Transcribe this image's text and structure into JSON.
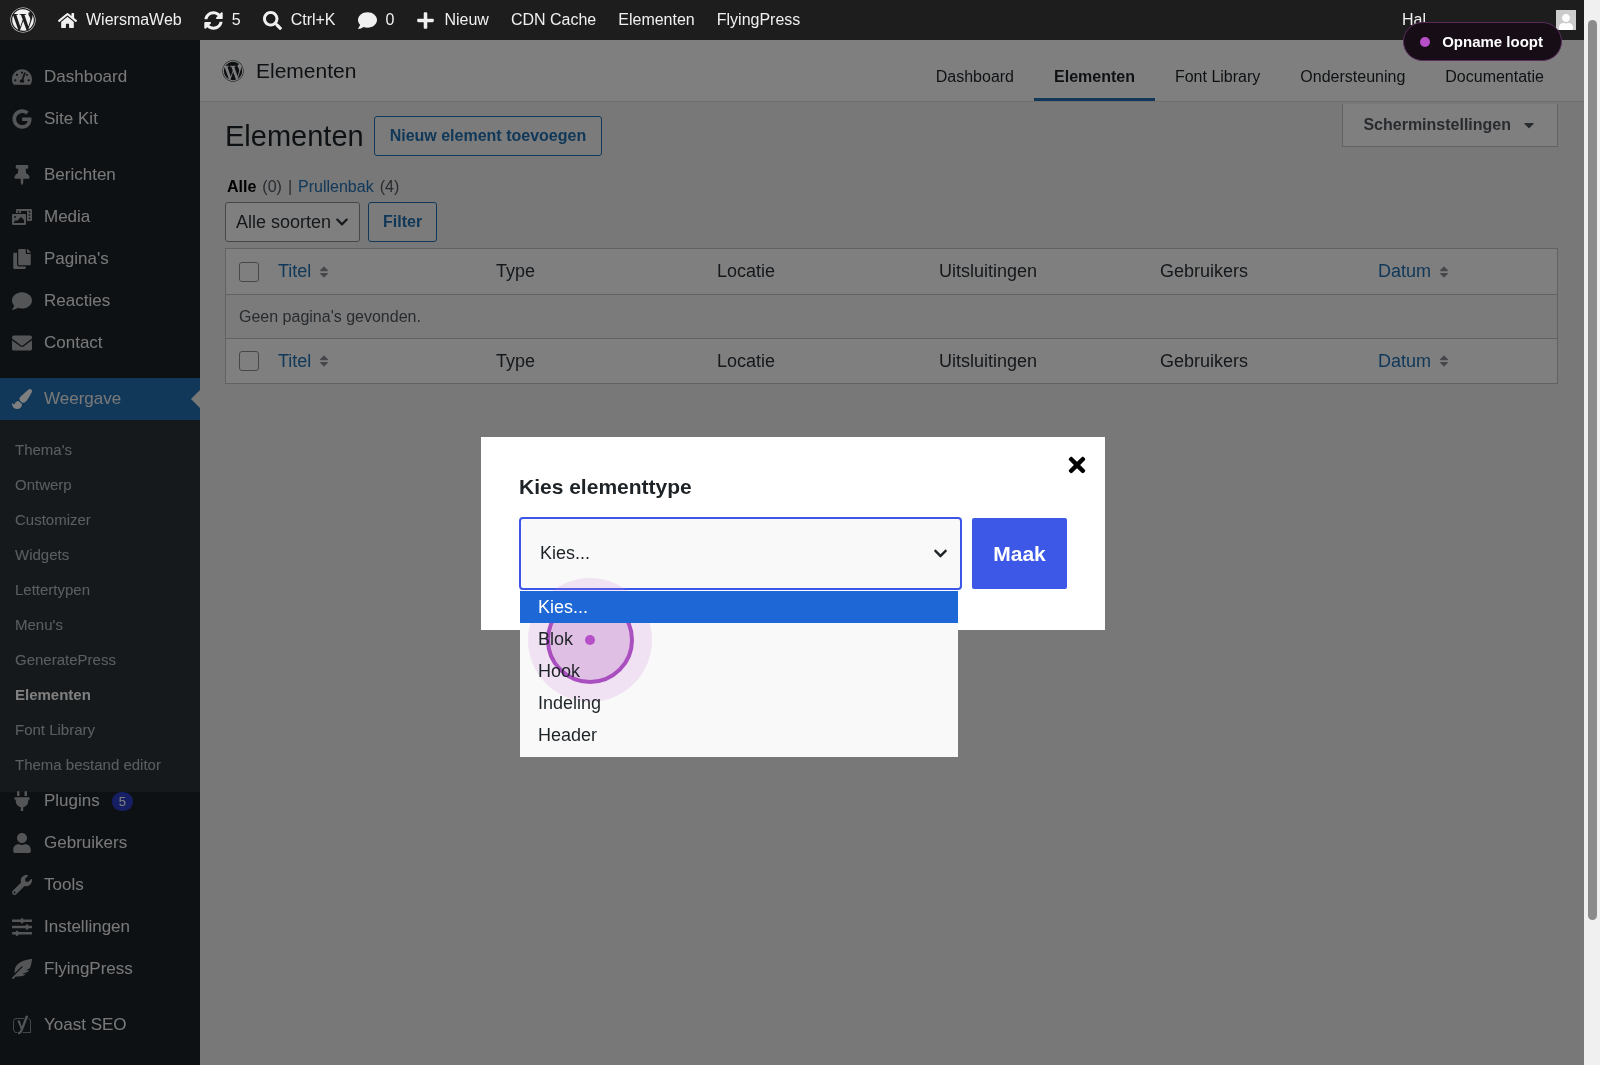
{
  "admin_bar": {
    "items": [
      {
        "kind": "logo"
      },
      {
        "kind": "home",
        "label": "WiersmaWeb"
      },
      {
        "kind": "updates",
        "label": "5"
      },
      {
        "kind": "search",
        "label": "Ctrl+K"
      },
      {
        "kind": "comments",
        "label": "0"
      },
      {
        "kind": "new",
        "label": "Nieuw"
      },
      {
        "kind": "text",
        "label": "CDN Cache"
      },
      {
        "kind": "text",
        "label": "Elementen"
      },
      {
        "kind": "text",
        "label": "FlyingPress"
      }
    ],
    "greeting": "Hal"
  },
  "recording_badge": {
    "label": "Opname loopt"
  },
  "sidebar": {
    "groups": [
      [
        {
          "label": "Dashboard",
          "selected": false
        },
        {
          "label": "Site Kit",
          "selected": false
        }
      ],
      [
        {
          "label": "Berichten",
          "selected": false
        },
        {
          "label": "Media",
          "selected": false
        },
        {
          "label": "Pagina's",
          "selected": false
        },
        {
          "label": "Reacties",
          "selected": false
        },
        {
          "label": "Contact",
          "selected": false
        }
      ],
      [
        {
          "label": "Weergave",
          "selected": true,
          "children": [
            {
              "label": "Thema's",
              "selected": false
            },
            {
              "label": "Ontwerp",
              "selected": false
            },
            {
              "label": "Customizer",
              "selected": false
            },
            {
              "label": "Widgets",
              "selected": false
            },
            {
              "label": "Lettertypen",
              "selected": false
            },
            {
              "label": "Menu's",
              "selected": false
            },
            {
              "label": "GeneratePress",
              "selected": false
            },
            {
              "label": "Elementen",
              "selected": true
            },
            {
              "label": "Font Library",
              "selected": false
            },
            {
              "label": "Thema bestand editor",
              "selected": false
            }
          ]
        },
        {
          "label": "Plugins",
          "selected": false,
          "badge": "5"
        },
        {
          "label": "Gebruikers",
          "selected": false
        },
        {
          "label": "Tools",
          "selected": false
        },
        {
          "label": "Instellingen",
          "selected": false
        },
        {
          "label": "FlyingPress",
          "selected": false
        }
      ],
      [
        {
          "label": "Yoast SEO",
          "selected": false
        }
      ]
    ]
  },
  "header": {
    "title": "Elementen",
    "tabs": [
      {
        "label": "Dashboard",
        "selected": false
      },
      {
        "label": "Elementen",
        "selected": true
      },
      {
        "label": "Font Library",
        "selected": false
      },
      {
        "label": "Ondersteuning",
        "selected": false
      },
      {
        "label": "Documentatie",
        "selected": false
      }
    ]
  },
  "screen_options": "Scherminstellingen",
  "page": {
    "title": "Elementen",
    "add_button": "Nieuw element toevoegen",
    "views": [
      {
        "label": "Alle",
        "count": "(0)",
        "selected": true
      },
      {
        "label": "Prullenbak",
        "count": "(4)",
        "selected": false
      }
    ],
    "views_separator": "|",
    "type_filter": "Alle soorten",
    "filter_button": "Filter"
  },
  "table": {
    "columns": [
      {
        "label": "Titel",
        "sortable": true
      },
      {
        "label": "Type",
        "sortable": false
      },
      {
        "label": "Locatie",
        "sortable": false
      },
      {
        "label": "Uitsluitingen",
        "sortable": false
      },
      {
        "label": "Gebruikers",
        "sortable": false
      },
      {
        "label": "Datum",
        "sortable": true
      }
    ],
    "footer_columns": [
      {
        "label": "Titel",
        "sortable": true
      },
      {
        "label": "Type",
        "sortable": false
      },
      {
        "label": "Locatie",
        "sortable": false
      },
      {
        "label": "Uitsluitingen",
        "sortable": false
      },
      {
        "label": "Gebruikers",
        "sortable": false
      },
      {
        "label": "Datum",
        "sortable": true
      }
    ],
    "select_all": {
      "checked": false
    },
    "empty_message": "Geen pagina's gevonden.",
    "footer_select_all": {
      "checked": false
    }
  },
  "modal": {
    "title": "Kies elementtype",
    "select_value": "Kies...",
    "button": "Maak",
    "options": [
      {
        "label": "Kies...",
        "selected": true
      },
      {
        "label": "Blok",
        "selected": false
      },
      {
        "label": "Hook",
        "selected": false
      },
      {
        "label": "Indeling",
        "selected": false
      },
      {
        "label": "Header",
        "selected": false
      }
    ]
  }
}
